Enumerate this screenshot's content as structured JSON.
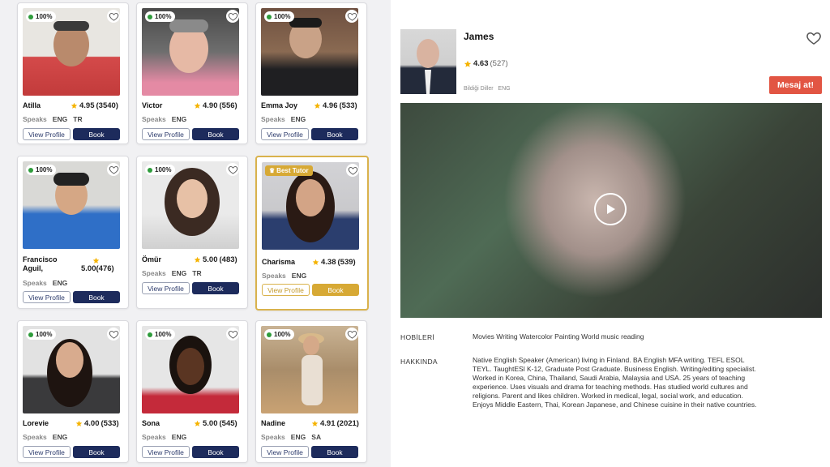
{
  "tutors": [
    {
      "name": "Atilla",
      "rating": "4.95",
      "count": "(3540)",
      "badge": "100%",
      "speaks_label": "Speaks",
      "languages": "ENG   TR",
      "view_label": "View Profile",
      "book_label": "Book"
    },
    {
      "name": "Victor",
      "rating": "4.90",
      "count": "(556)",
      "badge": "100%",
      "speaks_label": "Speaks",
      "languages": "ENG",
      "view_label": "View Profile",
      "book_label": "Book"
    },
    {
      "name": "Emma Joy",
      "rating": "4.96",
      "count": "(533)",
      "badge": "100%",
      "speaks_label": "Speaks",
      "languages": "ENG",
      "view_label": "View Profile",
      "book_label": "Book"
    },
    {
      "name": "Francisco Aguil,",
      "rating": "5.00",
      "count": "(476)",
      "badge": "100%",
      "speaks_label": "Speaks",
      "languages": "ENG",
      "view_label": "View Profile",
      "book_label": "Book"
    },
    {
      "name": "Ömür",
      "rating": "5.00",
      "count": "(483)",
      "badge": "100%",
      "speaks_label": "Speaks",
      "languages": "ENG   TR",
      "view_label": "View Profile",
      "book_label": "Book"
    },
    {
      "name": "Charisma",
      "rating": "4.38",
      "count": "(539)",
      "badge": "Best Tutor",
      "speaks_label": "Speaks",
      "languages": "ENG",
      "view_label": "View Profile",
      "book_label": "Book"
    },
    {
      "name": "Lorevie",
      "rating": "4.00",
      "count": "(533)",
      "badge": "100%",
      "speaks_label": "Speaks",
      "languages": "ENG",
      "view_label": "View Profile",
      "book_label": "Book"
    },
    {
      "name": "Sona",
      "rating": "5.00",
      "count": "(545)",
      "badge": "100%",
      "speaks_label": "Speaks",
      "languages": "ENG",
      "view_label": "View Profile",
      "book_label": "Book"
    },
    {
      "name": "Nadine",
      "rating": "4.91",
      "count": "(2021)",
      "badge": "100%",
      "speaks_label": "Speaks",
      "languages": "ENG   SA",
      "view_label": "View Profile",
      "book_label": "Book"
    }
  ],
  "profile": {
    "name": "James",
    "rating": "4.63",
    "count": "(527)",
    "languages_label": "Bildiği Diller",
    "languages": "ENG",
    "message_button": "Mesaj at!",
    "hobbies_label": "HOBİLERİ",
    "hobbies": "Movies Writing Watercolor Painting World music reading",
    "about_label": "HAKKINDA",
    "about": "Native English Speaker (American) living in Finland. BA English MFA writing. TEFL ESOL TEYL. TaughtESl K-12, Graduate Post Graduate. Business English. Writing/editing specialist. Worked in Korea, China, Thailand, Saudi Arabia, Malaysia and USA. 25 years of teaching experience. Uses visuals and drama for teaching methods. Has studied world cultures and religions. Parent and likes children. Worked in medical, legal, social work, and education. Enjoys Middle Eastern, Thai, Korean Japanese, and Chinese cuisine in their native countries."
  },
  "colors": {
    "star": "#f5b300",
    "book": "#1d2b5c",
    "best": "#d7a935",
    "message": "#e25543",
    "online": "#2e9c3b"
  }
}
